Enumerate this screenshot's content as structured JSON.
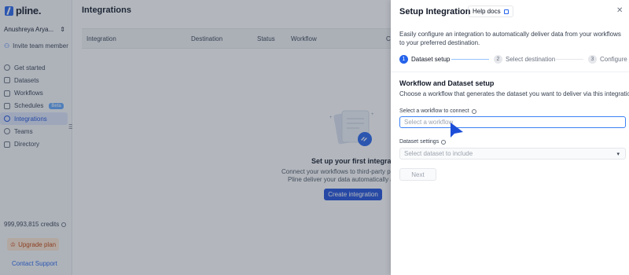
{
  "brand": {
    "name": "pline."
  },
  "sidebar": {
    "user_name": "Anushreya Arya...",
    "invite_label": "Invite team member",
    "items": [
      {
        "label": "Get started",
        "icon": "rocket-icon"
      },
      {
        "label": "Datasets",
        "icon": "database-icon"
      },
      {
        "label": "Workflows",
        "icon": "workflow-icon"
      },
      {
        "label": "Schedules",
        "icon": "calendar-icon",
        "badge": "Beta"
      },
      {
        "label": "Integrations",
        "icon": "link-icon",
        "active": true
      },
      {
        "label": "Teams",
        "icon": "users-icon"
      },
      {
        "label": "Directory",
        "icon": "folder-icon"
      }
    ],
    "credits": "999,993,815 credits",
    "upgrade_label": "Upgrade plan",
    "contact_label": "Contact Support"
  },
  "main": {
    "title": "Integrations",
    "columns": [
      "Integration",
      "Destination",
      "Status",
      "Workflow",
      "Cr"
    ],
    "empty_title": "Set up your first integration",
    "empty_desc_1": "Connect your workflows to third-party plat",
    "empty_desc_2": "Pline deliver your data automatically and",
    "create_label": "Create integration"
  },
  "drawer": {
    "title": "Setup Integration",
    "help_label": "Help docs",
    "description": "Easily configure an integration to automatically deliver data from your workflows to your preferred destination.",
    "steps": [
      {
        "num": "1",
        "label": "Dataset setup",
        "active": true
      },
      {
        "num": "2",
        "label": "Select destination",
        "active": false
      },
      {
        "num": "3",
        "label": "Configure",
        "active": false
      }
    ],
    "section_title": "Workflow and Dataset setup",
    "section_desc": "Choose a workflow that generates the dataset you want to deliver via this integration",
    "workflow_label": "Select a workflow to connect",
    "workflow_placeholder": "Select a workflow",
    "dataset_label": "Dataset settings",
    "dataset_placeholder": "Select dataset to include",
    "next_label": "Next"
  },
  "colors": {
    "accent": "#2563eb",
    "overlay": "#374151",
    "upgrade_bg": "#fde7d2",
    "upgrade_text": "#c2410c"
  }
}
